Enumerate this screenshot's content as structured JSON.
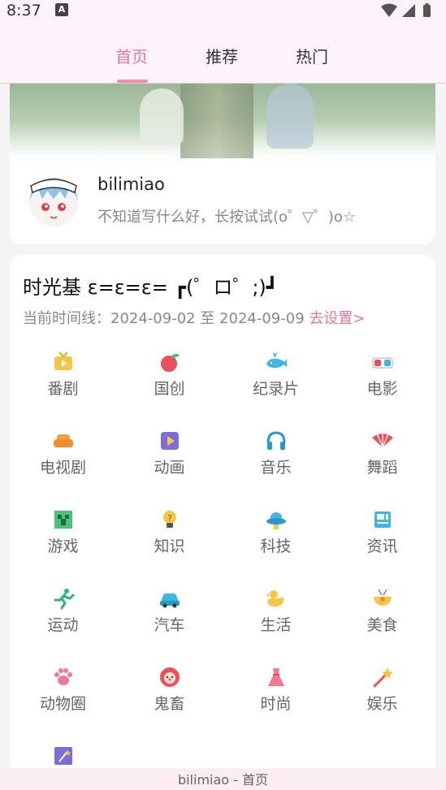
{
  "status_bar": {
    "time": "8:37",
    "notification_icon": "A"
  },
  "tabs": [
    {
      "label": "首页",
      "active": true
    },
    {
      "label": "推荐",
      "active": false
    },
    {
      "label": "热门",
      "active": false
    }
  ],
  "profile": {
    "username": "bilimiao",
    "signature": "不知道写什么好，长按试试(o゜▽゜)o☆"
  },
  "timeline": {
    "title": "时光基  ε=ε=ε= ┏(゜ロ゜;)┛",
    "range_label": "当前时间线：2024-09-02 至 2024-09-09",
    "set_link": "去设置>"
  },
  "categories": [
    {
      "label": "番剧",
      "icon": "tv-icon"
    },
    {
      "label": "国创",
      "icon": "peach-icon"
    },
    {
      "label": "纪录片",
      "icon": "whale-icon"
    },
    {
      "label": "电影",
      "icon": "3d-glasses-icon"
    },
    {
      "label": "电视剧",
      "icon": "sofa-icon"
    },
    {
      "label": "动画",
      "icon": "play-icon"
    },
    {
      "label": "音乐",
      "icon": "headphones-icon"
    },
    {
      "label": "舞蹈",
      "icon": "fan-icon"
    },
    {
      "label": "游戏",
      "icon": "creeper-icon"
    },
    {
      "label": "知识",
      "icon": "lightbulb-icon"
    },
    {
      "label": "科技",
      "icon": "ufo-icon"
    },
    {
      "label": "资讯",
      "icon": "news-icon"
    },
    {
      "label": "运动",
      "icon": "runner-icon"
    },
    {
      "label": "汽车",
      "icon": "car-icon"
    },
    {
      "label": "生活",
      "icon": "duck-icon"
    },
    {
      "label": "美食",
      "icon": "food-bowl-icon"
    },
    {
      "label": "动物圈",
      "icon": "paw-icon"
    },
    {
      "label": "鬼畜",
      "icon": "clown-icon"
    },
    {
      "label": "时尚",
      "icon": "dress-icon"
    },
    {
      "label": "娱乐",
      "icon": "magic-wand-icon"
    },
    {
      "label": "",
      "icon": "star-box-icon"
    }
  ],
  "bottom_bar": {
    "label": "bilimiao - 首页"
  },
  "colors": {
    "accent": "#e8799a",
    "header_bg": "#fcf2f7"
  }
}
